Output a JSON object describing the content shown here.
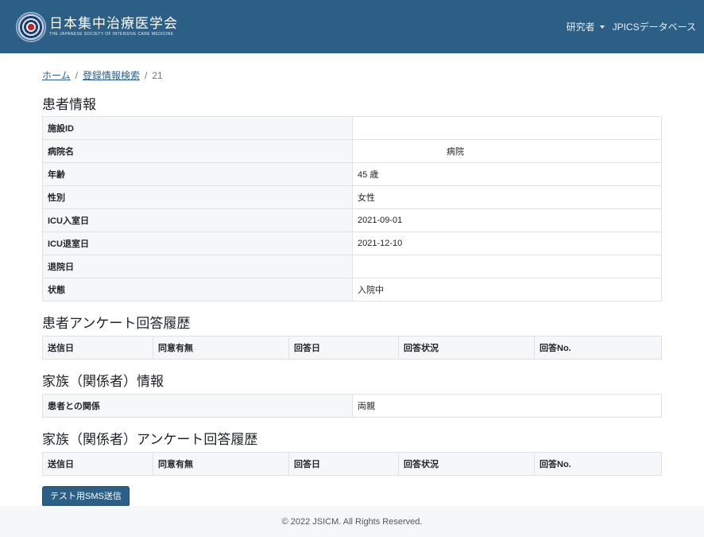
{
  "header": {
    "brand_jp": "日本集中治療医学会",
    "brand_en": "THE JAPANESE SOCIETY OF INTENSIVE CARE MEDICINE",
    "nav_researcher": "研究者",
    "nav_database": "JPICSデータベース",
    "bg_color": "#2c5f86"
  },
  "breadcrumb": {
    "home": "ホーム",
    "search": "登録情報検索",
    "current": "21",
    "sep1": "/",
    "sep2": "/"
  },
  "patient": {
    "title": "患者情報",
    "rows": [
      {
        "label": "施設ID",
        "value": ""
      },
      {
        "label": "病院名",
        "value": "病院"
      },
      {
        "label": "年齢",
        "value": "45 歳"
      },
      {
        "label": "性別",
        "value": "女性"
      },
      {
        "label": "ICU入室日",
        "value": "2021-09-01"
      },
      {
        "label": "ICU退室日",
        "value": "2021-12-10"
      },
      {
        "label": "退院日",
        "value": ""
      },
      {
        "label": "状態",
        "value": "入院中"
      }
    ]
  },
  "patient_survey": {
    "title": "患者アンケート回答履歴",
    "headers": [
      "送信日",
      "同意有無",
      "回答日",
      "回答状況",
      "回答No."
    ]
  },
  "family": {
    "title": "家族（関係者）情報",
    "rows": [
      {
        "label": "患者との関係",
        "value": "両親"
      }
    ]
  },
  "family_survey": {
    "title": "家族（関係者）アンケート回答履歴",
    "headers": [
      "送信日",
      "同意有無",
      "回答日",
      "回答状況",
      "回答No."
    ]
  },
  "actions": {
    "test_sms": "テスト用SMS送信"
  },
  "footer": {
    "copyright": "© 2022 JSICM. All Rights Reserved."
  }
}
